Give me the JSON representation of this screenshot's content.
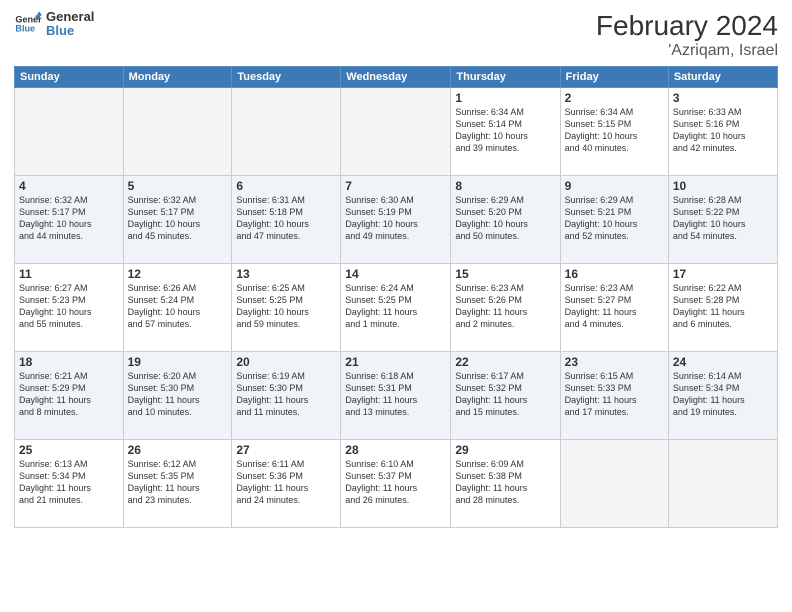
{
  "logo": {
    "line1": "General",
    "line2": "Blue"
  },
  "header": {
    "month_year": "February 2024",
    "location": "'Azriqam, Israel"
  },
  "weekdays": [
    "Sunday",
    "Monday",
    "Tuesday",
    "Wednesday",
    "Thursday",
    "Friday",
    "Saturday"
  ],
  "weeks": [
    [
      {
        "day": "",
        "info": ""
      },
      {
        "day": "",
        "info": ""
      },
      {
        "day": "",
        "info": ""
      },
      {
        "day": "",
        "info": ""
      },
      {
        "day": "1",
        "info": "Sunrise: 6:34 AM\nSunset: 5:14 PM\nDaylight: 10 hours\nand 39 minutes."
      },
      {
        "day": "2",
        "info": "Sunrise: 6:34 AM\nSunset: 5:15 PM\nDaylight: 10 hours\nand 40 minutes."
      },
      {
        "day": "3",
        "info": "Sunrise: 6:33 AM\nSunset: 5:16 PM\nDaylight: 10 hours\nand 42 minutes."
      }
    ],
    [
      {
        "day": "4",
        "info": "Sunrise: 6:32 AM\nSunset: 5:17 PM\nDaylight: 10 hours\nand 44 minutes."
      },
      {
        "day": "5",
        "info": "Sunrise: 6:32 AM\nSunset: 5:17 PM\nDaylight: 10 hours\nand 45 minutes."
      },
      {
        "day": "6",
        "info": "Sunrise: 6:31 AM\nSunset: 5:18 PM\nDaylight: 10 hours\nand 47 minutes."
      },
      {
        "day": "7",
        "info": "Sunrise: 6:30 AM\nSunset: 5:19 PM\nDaylight: 10 hours\nand 49 minutes."
      },
      {
        "day": "8",
        "info": "Sunrise: 6:29 AM\nSunset: 5:20 PM\nDaylight: 10 hours\nand 50 minutes."
      },
      {
        "day": "9",
        "info": "Sunrise: 6:29 AM\nSunset: 5:21 PM\nDaylight: 10 hours\nand 52 minutes."
      },
      {
        "day": "10",
        "info": "Sunrise: 6:28 AM\nSunset: 5:22 PM\nDaylight: 10 hours\nand 54 minutes."
      }
    ],
    [
      {
        "day": "11",
        "info": "Sunrise: 6:27 AM\nSunset: 5:23 PM\nDaylight: 10 hours\nand 55 minutes."
      },
      {
        "day": "12",
        "info": "Sunrise: 6:26 AM\nSunset: 5:24 PM\nDaylight: 10 hours\nand 57 minutes."
      },
      {
        "day": "13",
        "info": "Sunrise: 6:25 AM\nSunset: 5:25 PM\nDaylight: 10 hours\nand 59 minutes."
      },
      {
        "day": "14",
        "info": "Sunrise: 6:24 AM\nSunset: 5:25 PM\nDaylight: 11 hours\nand 1 minute."
      },
      {
        "day": "15",
        "info": "Sunrise: 6:23 AM\nSunset: 5:26 PM\nDaylight: 11 hours\nand 2 minutes."
      },
      {
        "day": "16",
        "info": "Sunrise: 6:23 AM\nSunset: 5:27 PM\nDaylight: 11 hours\nand 4 minutes."
      },
      {
        "day": "17",
        "info": "Sunrise: 6:22 AM\nSunset: 5:28 PM\nDaylight: 11 hours\nand 6 minutes."
      }
    ],
    [
      {
        "day": "18",
        "info": "Sunrise: 6:21 AM\nSunset: 5:29 PM\nDaylight: 11 hours\nand 8 minutes."
      },
      {
        "day": "19",
        "info": "Sunrise: 6:20 AM\nSunset: 5:30 PM\nDaylight: 11 hours\nand 10 minutes."
      },
      {
        "day": "20",
        "info": "Sunrise: 6:19 AM\nSunset: 5:30 PM\nDaylight: 11 hours\nand 11 minutes."
      },
      {
        "day": "21",
        "info": "Sunrise: 6:18 AM\nSunset: 5:31 PM\nDaylight: 11 hours\nand 13 minutes."
      },
      {
        "day": "22",
        "info": "Sunrise: 6:17 AM\nSunset: 5:32 PM\nDaylight: 11 hours\nand 15 minutes."
      },
      {
        "day": "23",
        "info": "Sunrise: 6:15 AM\nSunset: 5:33 PM\nDaylight: 11 hours\nand 17 minutes."
      },
      {
        "day": "24",
        "info": "Sunrise: 6:14 AM\nSunset: 5:34 PM\nDaylight: 11 hours\nand 19 minutes."
      }
    ],
    [
      {
        "day": "25",
        "info": "Sunrise: 6:13 AM\nSunset: 5:34 PM\nDaylight: 11 hours\nand 21 minutes."
      },
      {
        "day": "26",
        "info": "Sunrise: 6:12 AM\nSunset: 5:35 PM\nDaylight: 11 hours\nand 23 minutes."
      },
      {
        "day": "27",
        "info": "Sunrise: 6:11 AM\nSunset: 5:36 PM\nDaylight: 11 hours\nand 24 minutes."
      },
      {
        "day": "28",
        "info": "Sunrise: 6:10 AM\nSunset: 5:37 PM\nDaylight: 11 hours\nand 26 minutes."
      },
      {
        "day": "29",
        "info": "Sunrise: 6:09 AM\nSunset: 5:38 PM\nDaylight: 11 hours\nand 28 minutes."
      },
      {
        "day": "",
        "info": ""
      },
      {
        "day": "",
        "info": ""
      }
    ]
  ]
}
